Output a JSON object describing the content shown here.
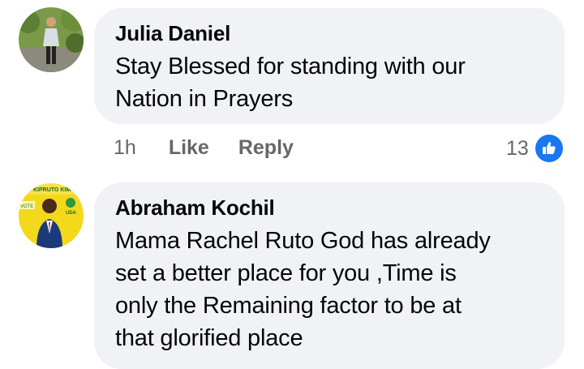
{
  "comments": [
    {
      "author": "Julia Daniel",
      "text_lines": [
        "Stay Blessed for standing with our",
        "Nation in Prayers"
      ],
      "time": "1h",
      "like_label": "Like",
      "reply_label": "Reply",
      "reaction_count": "13",
      "reaction_icon": "like-thumb-icon"
    },
    {
      "author": "Abraham Kochil",
      "text_lines": [
        "Mama Rachel Ruto God has already",
        "set a better place for you ,Time is",
        "only the Remaining factor to be at",
        "that glorified place"
      ],
      "avatar_text": {
        "top": "KIPRUTO KIM",
        "left": "VOTE",
        "right": "UDA"
      }
    }
  ],
  "colors": {
    "bubble": "#f0f2f5",
    "text": "#050505",
    "secondary": "#65676b",
    "like_blue": "#1877f2",
    "avatar2_bg": "#f3d81c"
  }
}
